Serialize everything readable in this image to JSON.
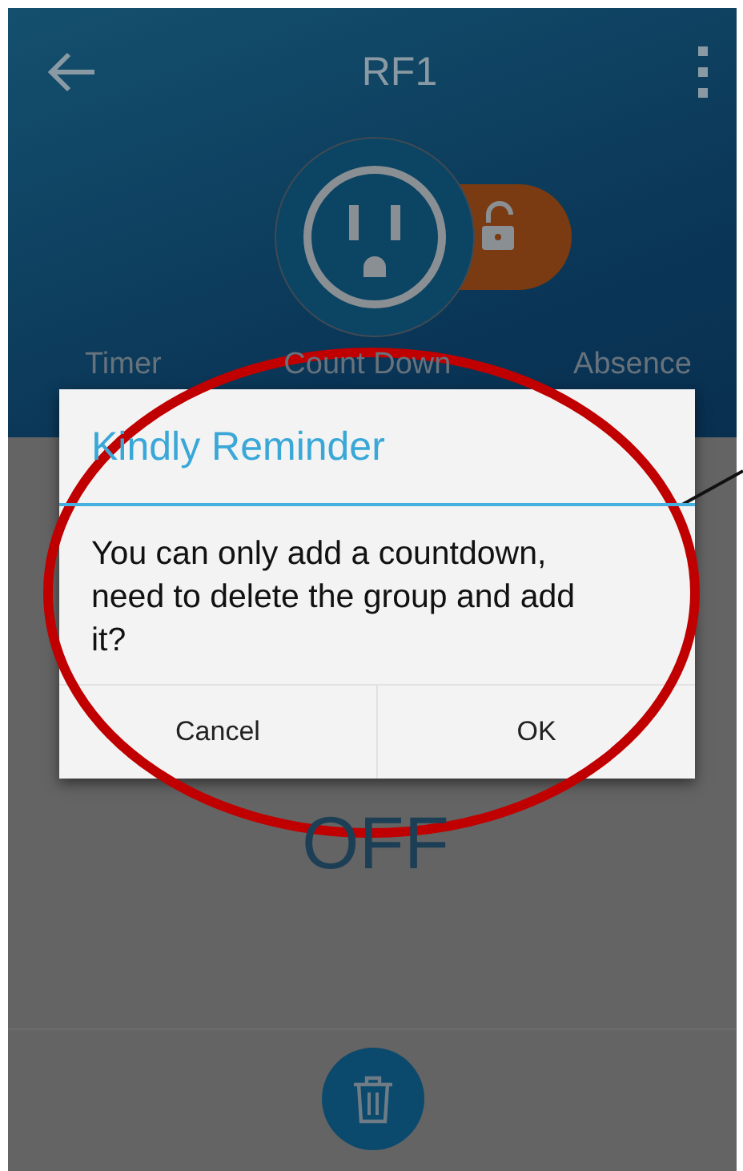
{
  "app_bar": {
    "title": "RF1"
  },
  "tabs": [
    {
      "label": "Timer"
    },
    {
      "label": "Count Down"
    },
    {
      "label": "Absence"
    }
  ],
  "status": "OFF",
  "dialog": {
    "title": "Kindly Reminder",
    "message": "You can only add a countdown, need to delete the group and add it?",
    "buttons": [
      "Cancel",
      "OK"
    ]
  }
}
